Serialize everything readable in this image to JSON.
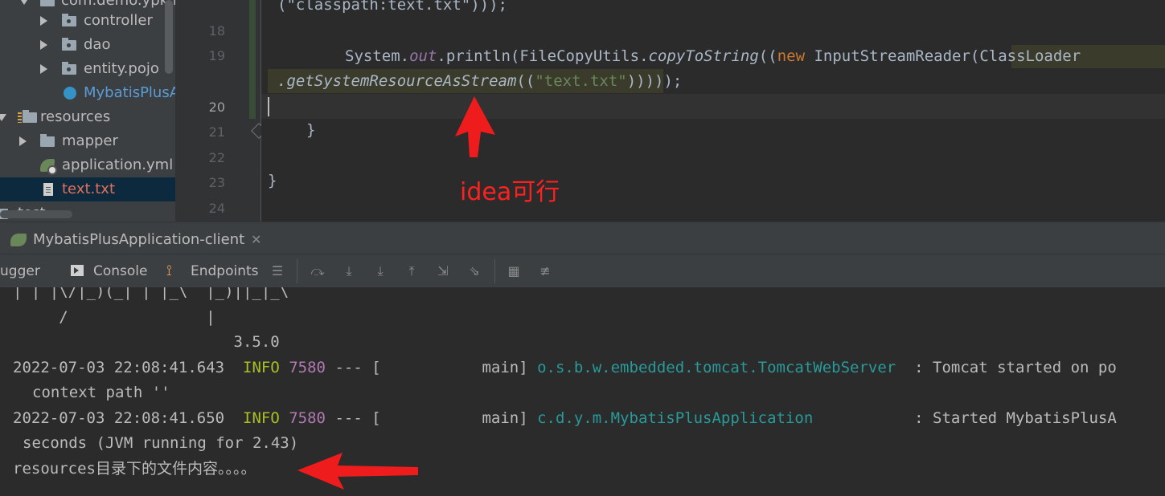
{
  "project_tree": {
    "items": [
      {
        "label": "com.demo.ypk.m",
        "kind": "package"
      },
      {
        "label": "controller",
        "kind": "package"
      },
      {
        "label": "dao",
        "kind": "package"
      },
      {
        "label": "entity.pojo",
        "kind": "package"
      },
      {
        "label": "MybatisPlusA",
        "kind": "spring-boot-class"
      },
      {
        "label": "resources",
        "kind": "resource-folder"
      },
      {
        "label": "mapper",
        "kind": "folder"
      },
      {
        "label": "application.yml",
        "kind": "spring-config"
      },
      {
        "label": "text.txt",
        "kind": "text-file",
        "selected": true
      },
      {
        "label": "test",
        "kind": "folder"
      }
    ]
  },
  "editor": {
    "line_numbers": [
      "18",
      "19",
      "20",
      "21",
      "22",
      "23",
      "24"
    ],
    "current_line": "20",
    "code_lines": {
      "l0": "(\"classpath:text.txt\")));",
      "l19a_1": "System.",
      "l19a_2": "out",
      "l19a_3": ".println(FileCopyUtils.",
      "l19a_4": "copyToString",
      "l19a_5": "((",
      "l19a_6": "new",
      "l19a_7": " InputStreamReader(",
      "l19a_8": "ClassLoader",
      "l19b_1": ".getSystemResourceAsStream",
      "l19b_2": "((",
      "l19b_3": "\"text.txt\"",
      "l19b_4": "))",
      "l19b_5": ")));",
      "l21": "}",
      "l23": "}"
    }
  },
  "annotations": {
    "editor_note": "idea可行"
  },
  "run_panel": {
    "tab_title": "MybatisPlusApplication-client",
    "toolbar": {
      "debugger_label": "ugger",
      "console_label": "Console",
      "endpoints_label": "Endpoints"
    },
    "console_lines": {
      "banner1": "| | |\\/|_)(_| | |_\\  |_)||_|_\\",
      "banner2": "     /               |",
      "banner3": "                        3.5.0",
      "log1_ts": "2022-07-03 22:08:41.643",
      "log1_level": "INFO",
      "log1_pid": "7580",
      "log1_thread": "--- [           main]",
      "log1_logger": "o.s.b.w.embedded.tomcat.TomcatWebServer",
      "log1_msg": ": Tomcat started on po",
      "log1_cont": "context path ''",
      "log2_ts": "2022-07-03 22:08:41.650",
      "log2_level": "INFO",
      "log2_pid": "7580",
      "log2_thread": "--- [           main]",
      "log2_logger": "c.d.y.m.MybatisPlusApplication",
      "log2_msg": ": Started MybatisPlusA",
      "log2_cont": "seconds (JVM running for 2.43)",
      "output": "resources目录下的文件内容。。。。"
    }
  },
  "colors": {
    "annotation_red": "#ff2020",
    "keyword": "#cc7832",
    "string": "#6a8759",
    "info": "#a8c023",
    "logger": "#299999"
  }
}
